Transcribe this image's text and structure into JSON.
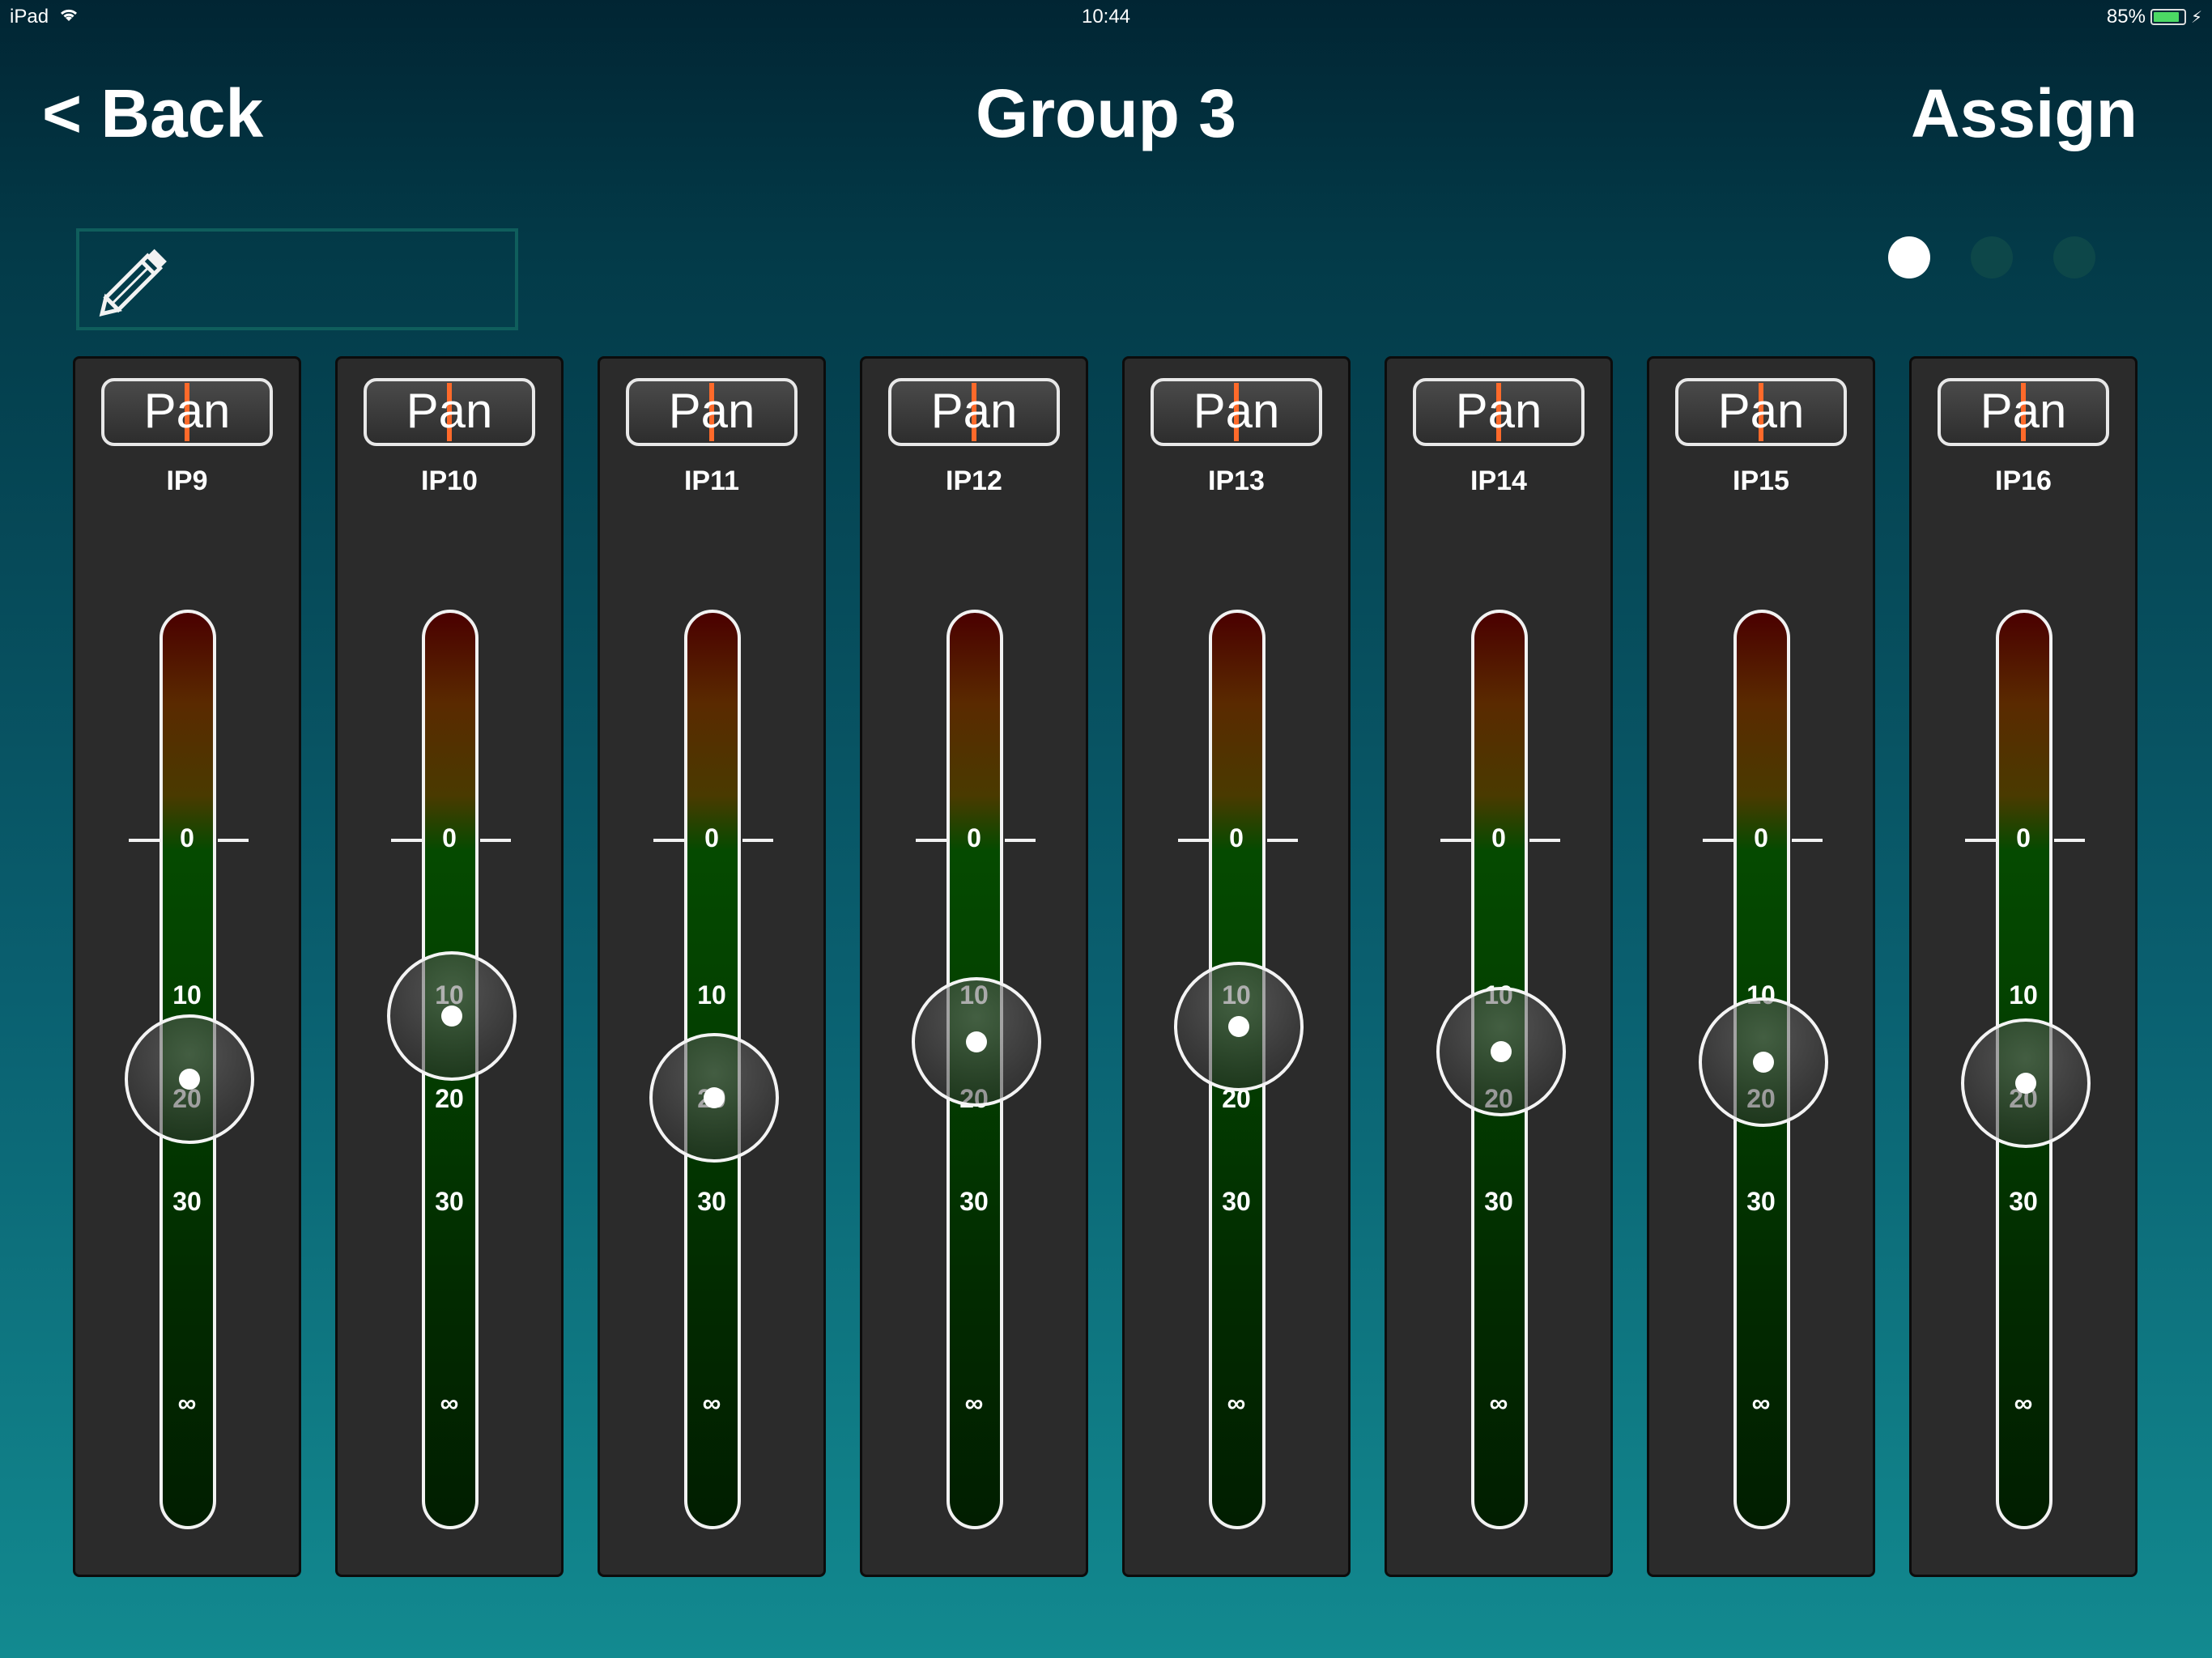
{
  "status_bar": {
    "device": "iPad",
    "time": "10:44",
    "battery": "85%",
    "battery_level": 0.85,
    "icons": [
      "wifi-icon",
      "battery-icon",
      "charging-bolt-icon"
    ]
  },
  "nav": {
    "back_label": "< Back",
    "title": "Group 3",
    "assign_label": "Assign"
  },
  "name_field": {
    "value": "",
    "icon": "pencil-icon"
  },
  "pages": {
    "count": 3,
    "active": 0
  },
  "fader_scale": [
    "0",
    "10",
    "20",
    "30",
    "∞"
  ],
  "channels": [
    {
      "pan_label": "Pan",
      "name": "IP9",
      "pan": 0,
      "fader_level": 0.489
    },
    {
      "pan_label": "Pan",
      "name": "IP10",
      "pan": 0,
      "fader_level": 0.558
    },
    {
      "pan_label": "Pan",
      "name": "IP11",
      "pan": 0,
      "fader_level": 0.469
    },
    {
      "pan_label": "Pan",
      "name": "IP12",
      "pan": 0,
      "fader_level": 0.53
    },
    {
      "pan_label": "Pan",
      "name": "IP13",
      "pan": 0,
      "fader_level": 0.547
    },
    {
      "pan_label": "Pan",
      "name": "IP14",
      "pan": 0,
      "fader_level": 0.519
    },
    {
      "pan_label": "Pan",
      "name": "IP15",
      "pan": 0,
      "fader_level": 0.508
    },
    {
      "pan_label": "Pan",
      "name": "IP16",
      "pan": 0,
      "fader_level": 0.485
    }
  ],
  "colors": {
    "pan_marker": "#ff6a2a",
    "strip_background": "#2b2b2b",
    "active_dot": "#ffffff",
    "inactive_dot": "#0d4749"
  }
}
